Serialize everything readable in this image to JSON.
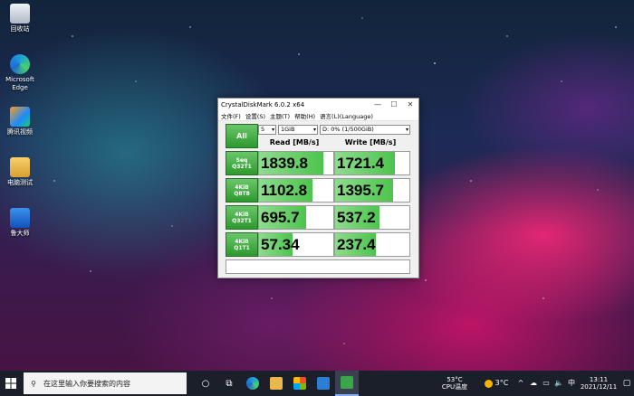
{
  "desktop": {
    "icons": [
      {
        "label": "回收站",
        "icon": "recycle-bin-icon",
        "color": "#d0d8e0"
      },
      {
        "label": "Microsoft Edge",
        "icon": "edge-icon",
        "color": "#1e9be0"
      },
      {
        "label": "腾讯视频",
        "icon": "tencent-video-icon",
        "color": "#1a8cff"
      },
      {
        "label": "电脑测试",
        "icon": "folder-icon",
        "color": "#e8b84a"
      },
      {
        "label": "鲁大师",
        "icon": "ludashi-icon",
        "color": "#1f6fd6"
      }
    ]
  },
  "window": {
    "title": "CrystalDiskMark 6.0.2 x64",
    "controls": {
      "minimize": "—",
      "maximize": "☐",
      "close": "✕"
    },
    "menu": [
      "文件(F)",
      "设置(S)",
      "主题(T)",
      "帮助(H)",
      "语言(L)(Language)"
    ],
    "all_button": "All",
    "count_select": "5",
    "size_select": "1GiB",
    "drive_select": "D: 0% (1/500GiB)",
    "read_header": "Read [MB/s]",
    "write_header": "Write [MB/s]",
    "rows": [
      {
        "line1": "Seq",
        "line2": "Q32T1",
        "read": "1839.8",
        "write": "1721.4",
        "read_fill": 0.86,
        "write_fill": 0.81
      },
      {
        "line1": "4KiB",
        "line2": "Q8T8",
        "read": "1102.8",
        "write": "1395.7",
        "read_fill": 0.72,
        "write_fill": 0.78
      },
      {
        "line1": "4KiB",
        "line2": "Q32T1",
        "read": "695.7",
        "write": "537.2",
        "read_fill": 0.63,
        "write_fill": 0.6
      },
      {
        "line1": "4KiB",
        "line2": "Q1T1",
        "read": "57.34",
        "write": "237.4",
        "read_fill": 0.45,
        "write_fill": 0.55
      }
    ],
    "comment": ""
  },
  "taskbar": {
    "search_placeholder": "在这里输入你要搜索的内容",
    "cpu_temp": "53°C",
    "cpu_label": "CPU温度",
    "weather": "3°C",
    "time": "13:11",
    "date": "2021/12/11",
    "ime": "中"
  },
  "colors": {
    "accent_green": "#2c9a2c",
    "bar_green": "#4cc44c",
    "taskbar": "#1a1f2a"
  }
}
